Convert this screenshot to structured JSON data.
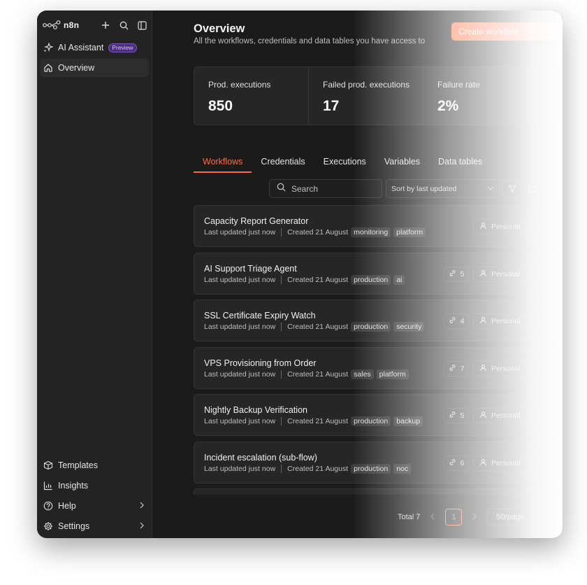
{
  "app": {
    "name": "n8n"
  },
  "sidebar": {
    "top_items": [
      {
        "label": "AI Assistant",
        "badge": "Preview",
        "icon": "sparkles-icon"
      },
      {
        "label": "Overview",
        "icon": "home-icon",
        "active": true
      }
    ],
    "bottom_items": [
      {
        "label": "Templates",
        "icon": "box-icon"
      },
      {
        "label": "Insights",
        "icon": "bar-chart-icon"
      },
      {
        "label": "Help",
        "icon": "help-circle-icon"
      },
      {
        "label": "Settings",
        "icon": "gear-icon"
      }
    ]
  },
  "header": {
    "title": "Overview",
    "subtitle": "All the workflows, credentials and data tables you have access to",
    "create_label": "Create workflow"
  },
  "stats": [
    {
      "label": "Prod. executions",
      "value": "850"
    },
    {
      "label": "Failed prod. executions",
      "value": "17"
    },
    {
      "label": "Failure rate",
      "value": "2%"
    }
  ],
  "tabs": [
    "Workflows",
    "Credentials",
    "Executions",
    "Variables",
    "Data tables"
  ],
  "toolbar": {
    "search_placeholder": "Search",
    "sort_label": "Sort by last updated"
  },
  "workflows": [
    {
      "name": "Capacity Report Generator",
      "updated": "Last updated just now",
      "created": "Created 21 August",
      "tags": [
        "monitoring",
        "platform"
      ],
      "links": "",
      "owner": "Personal"
    },
    {
      "name": "AI Support Triage Agent",
      "updated": "Last updated just now",
      "created": "Created 21 August",
      "tags": [
        "production",
        "ai"
      ],
      "links": "5",
      "owner": "Personal"
    },
    {
      "name": "SSL Certificate Expiry Watch",
      "updated": "Last updated just now",
      "created": "Created 21 August",
      "tags": [
        "production",
        "security"
      ],
      "links": "4",
      "owner": "Personal"
    },
    {
      "name": "VPS Provisioning from Order",
      "updated": "Last updated just now",
      "created": "Created 21 August",
      "tags": [
        "sales",
        "platform"
      ],
      "links": "7",
      "owner": "Personal"
    },
    {
      "name": "Nightly Backup Verification",
      "updated": "Last updated just now",
      "created": "Created 21 August",
      "tags": [
        "production",
        "backup"
      ],
      "links": "5",
      "owner": "Personal"
    },
    {
      "name": "Incident escalation (sub-flow)",
      "updated": "Last updated just now",
      "created": "Created 21 August",
      "tags": [
        "production",
        "noc"
      ],
      "links": "6",
      "owner": "Personal"
    }
  ],
  "pagination": {
    "total": "Total 7",
    "current": "1",
    "per_page": "50/page"
  }
}
